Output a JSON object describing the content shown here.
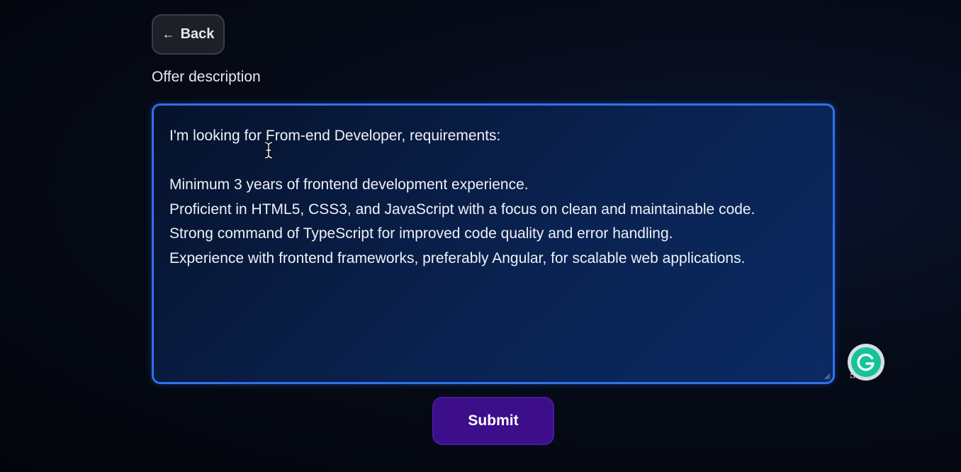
{
  "back_button": {
    "label": "Back",
    "icon": "arrow-left-icon"
  },
  "offer_field": {
    "label": "Offer description",
    "value": "I'm looking for From-end Developer, requirements:\n\nMinimum 3 years of frontend development experience.\nProficient in HTML5, CSS3, and JavaScript with a focus on clean and maintainable code.\nStrong command of TypeScript for improved code quality and error handling.\nExperience with frontend frameworks, preferably Angular, for scalable web applications."
  },
  "submit_button": {
    "label": "Submit"
  },
  "icons": {
    "grammarly": "grammarly-icon",
    "text_cursor": "text-cursor-icon",
    "resize_handle": "resize-handle-icon"
  },
  "colors": {
    "textarea_border": "#2f72ea",
    "submit_background": "#3c0e8a",
    "grammarly_green": "#15c39a"
  }
}
